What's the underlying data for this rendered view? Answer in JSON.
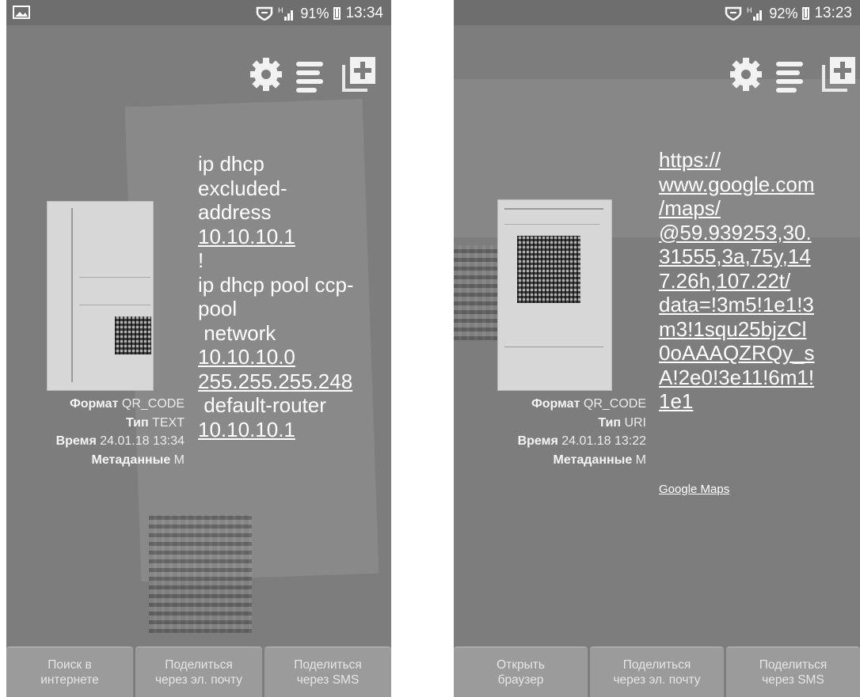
{
  "left": {
    "status": {
      "signal_label": "H",
      "battery": "91%",
      "time": "13:34"
    },
    "meta": {
      "format_label": "Формат",
      "format_value": "QR_CODE",
      "type_label": "Тип",
      "type_value": "TEXT",
      "time_label": "Время",
      "time_value": "24.01.18 13:34",
      "metadata_label": "Метаданные",
      "metadata_value": "M"
    },
    "content_lines": [
      "ip dhcp",
      "excluded-",
      "address",
      "10.10.10.1",
      "!",
      "ip dhcp pool ccp-",
      "pool",
      " network",
      "10.10.10.0",
      "255.255.255.248",
      " default-router",
      "10.10.10.1"
    ],
    "buttons": [
      {
        "line1": "Поиск в",
        "line2": "интернете"
      },
      {
        "line1": "Поделиться",
        "line2": "через эл. почту"
      },
      {
        "line1": "Поделиться",
        "line2": "через SMS"
      }
    ]
  },
  "right": {
    "status": {
      "signal_label": "H",
      "battery": "92%",
      "time": "13:23"
    },
    "meta": {
      "format_label": "Формат",
      "format_value": "QR_CODE",
      "type_label": "Тип",
      "type_value": "URI",
      "time_label": "Время",
      "time_value": "24.01.18 13:22",
      "metadata_label": "Метаданные",
      "metadata_value": "M"
    },
    "content_lines": [
      "https://",
      "www.google.com",
      "/maps/",
      "@59.939253,30.",
      "31555,3a,75y,14",
      "7.26h,107.22t/",
      "data=!3m5!1e1!3",
      "m3!1squ25bjzCl",
      "0oAAAQZRQy_s",
      "A!2e0!3e11!6m1!",
      "1e1"
    ],
    "link_caption": "Google Maps",
    "buttons": [
      {
        "line1": "Открыть",
        "line2": "браузер"
      },
      {
        "line1": "Поделиться",
        "line2": "через эл. почту"
      },
      {
        "line1": "Поделиться",
        "line2": "через SMS"
      }
    ]
  },
  "icons": [
    "gallery-icon",
    "shield-icon",
    "signal-icon",
    "battery-icon",
    "gear-icon",
    "history-icon",
    "add-shortcut-icon"
  ]
}
